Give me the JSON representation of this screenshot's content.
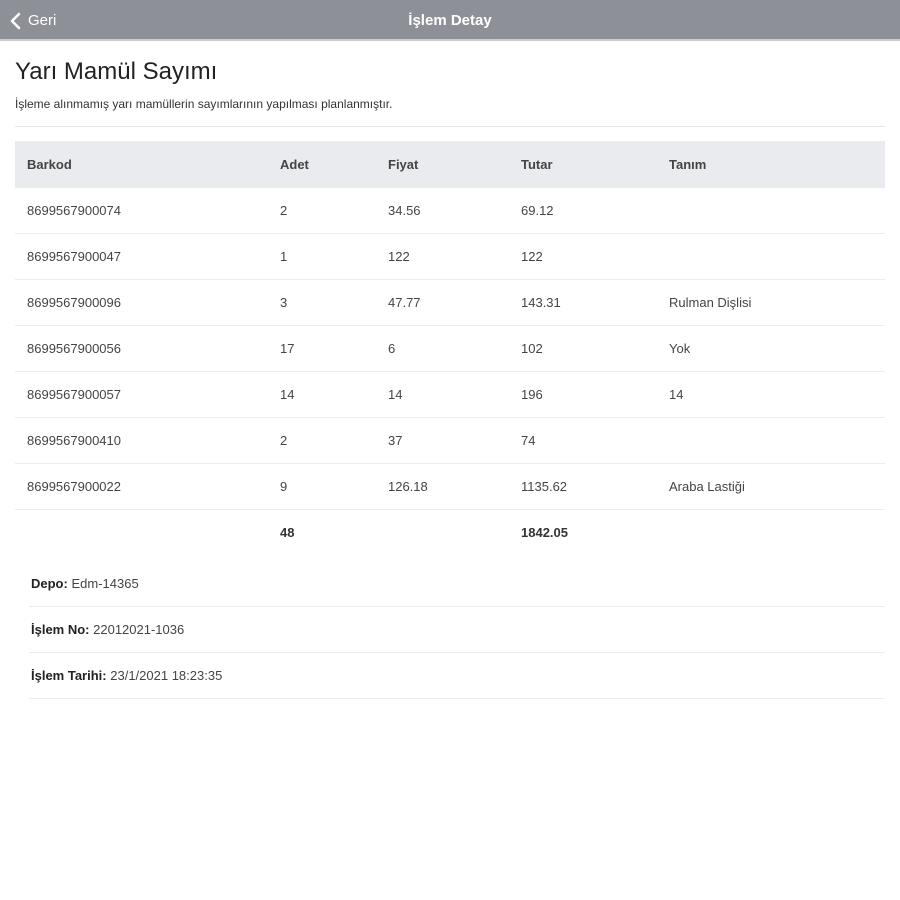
{
  "navbar": {
    "back_label": "Geri",
    "title": "İşlem Detay"
  },
  "page": {
    "title": "Yarı Mamül Sayımı",
    "subtitle": "İşleme alınmamış yarı mamüllerin sayımlarının yapılması planlanmıştır."
  },
  "table": {
    "headers": {
      "barkod": "Barkod",
      "adet": "Adet",
      "fiyat": "Fiyat",
      "tutar": "Tutar",
      "tanim": "Tanım"
    },
    "rows": [
      {
        "barkod": "8699567900074",
        "adet": "2",
        "fiyat": "34.56",
        "tutar": "69.12",
        "tanim": ""
      },
      {
        "barkod": "8699567900047",
        "adet": "1",
        "fiyat": "122",
        "tutar": "122",
        "tanim": ""
      },
      {
        "barkod": "8699567900096",
        "adet": "3",
        "fiyat": "47.77",
        "tutar": "143.31",
        "tanim": "Rulman Dişlisi"
      },
      {
        "barkod": "8699567900056",
        "adet": "17",
        "fiyat": "6",
        "tutar": "102",
        "tanim": "Yok"
      },
      {
        "barkod": "8699567900057",
        "adet": "14",
        "fiyat": "14",
        "tutar": "196",
        "tanim": "14"
      },
      {
        "barkod": "8699567900410",
        "adet": "2",
        "fiyat": "37",
        "tutar": "74",
        "tanim": ""
      },
      {
        "barkod": "8699567900022",
        "adet": "9",
        "fiyat": "126.18",
        "tutar": "1135.62",
        "tanim": "Araba Lastiği"
      }
    ],
    "totals": {
      "adet": "48",
      "tutar": "1842.05"
    }
  },
  "info": {
    "depo_label": "Depo:",
    "depo_value": "Edm-14365",
    "islem_no_label": "İşlem No:",
    "islem_no_value": "22012021-1036",
    "islem_tarihi_label": "İşlem Tarihi:",
    "islem_tarihi_value": "23/1/2021 18:23:35"
  }
}
